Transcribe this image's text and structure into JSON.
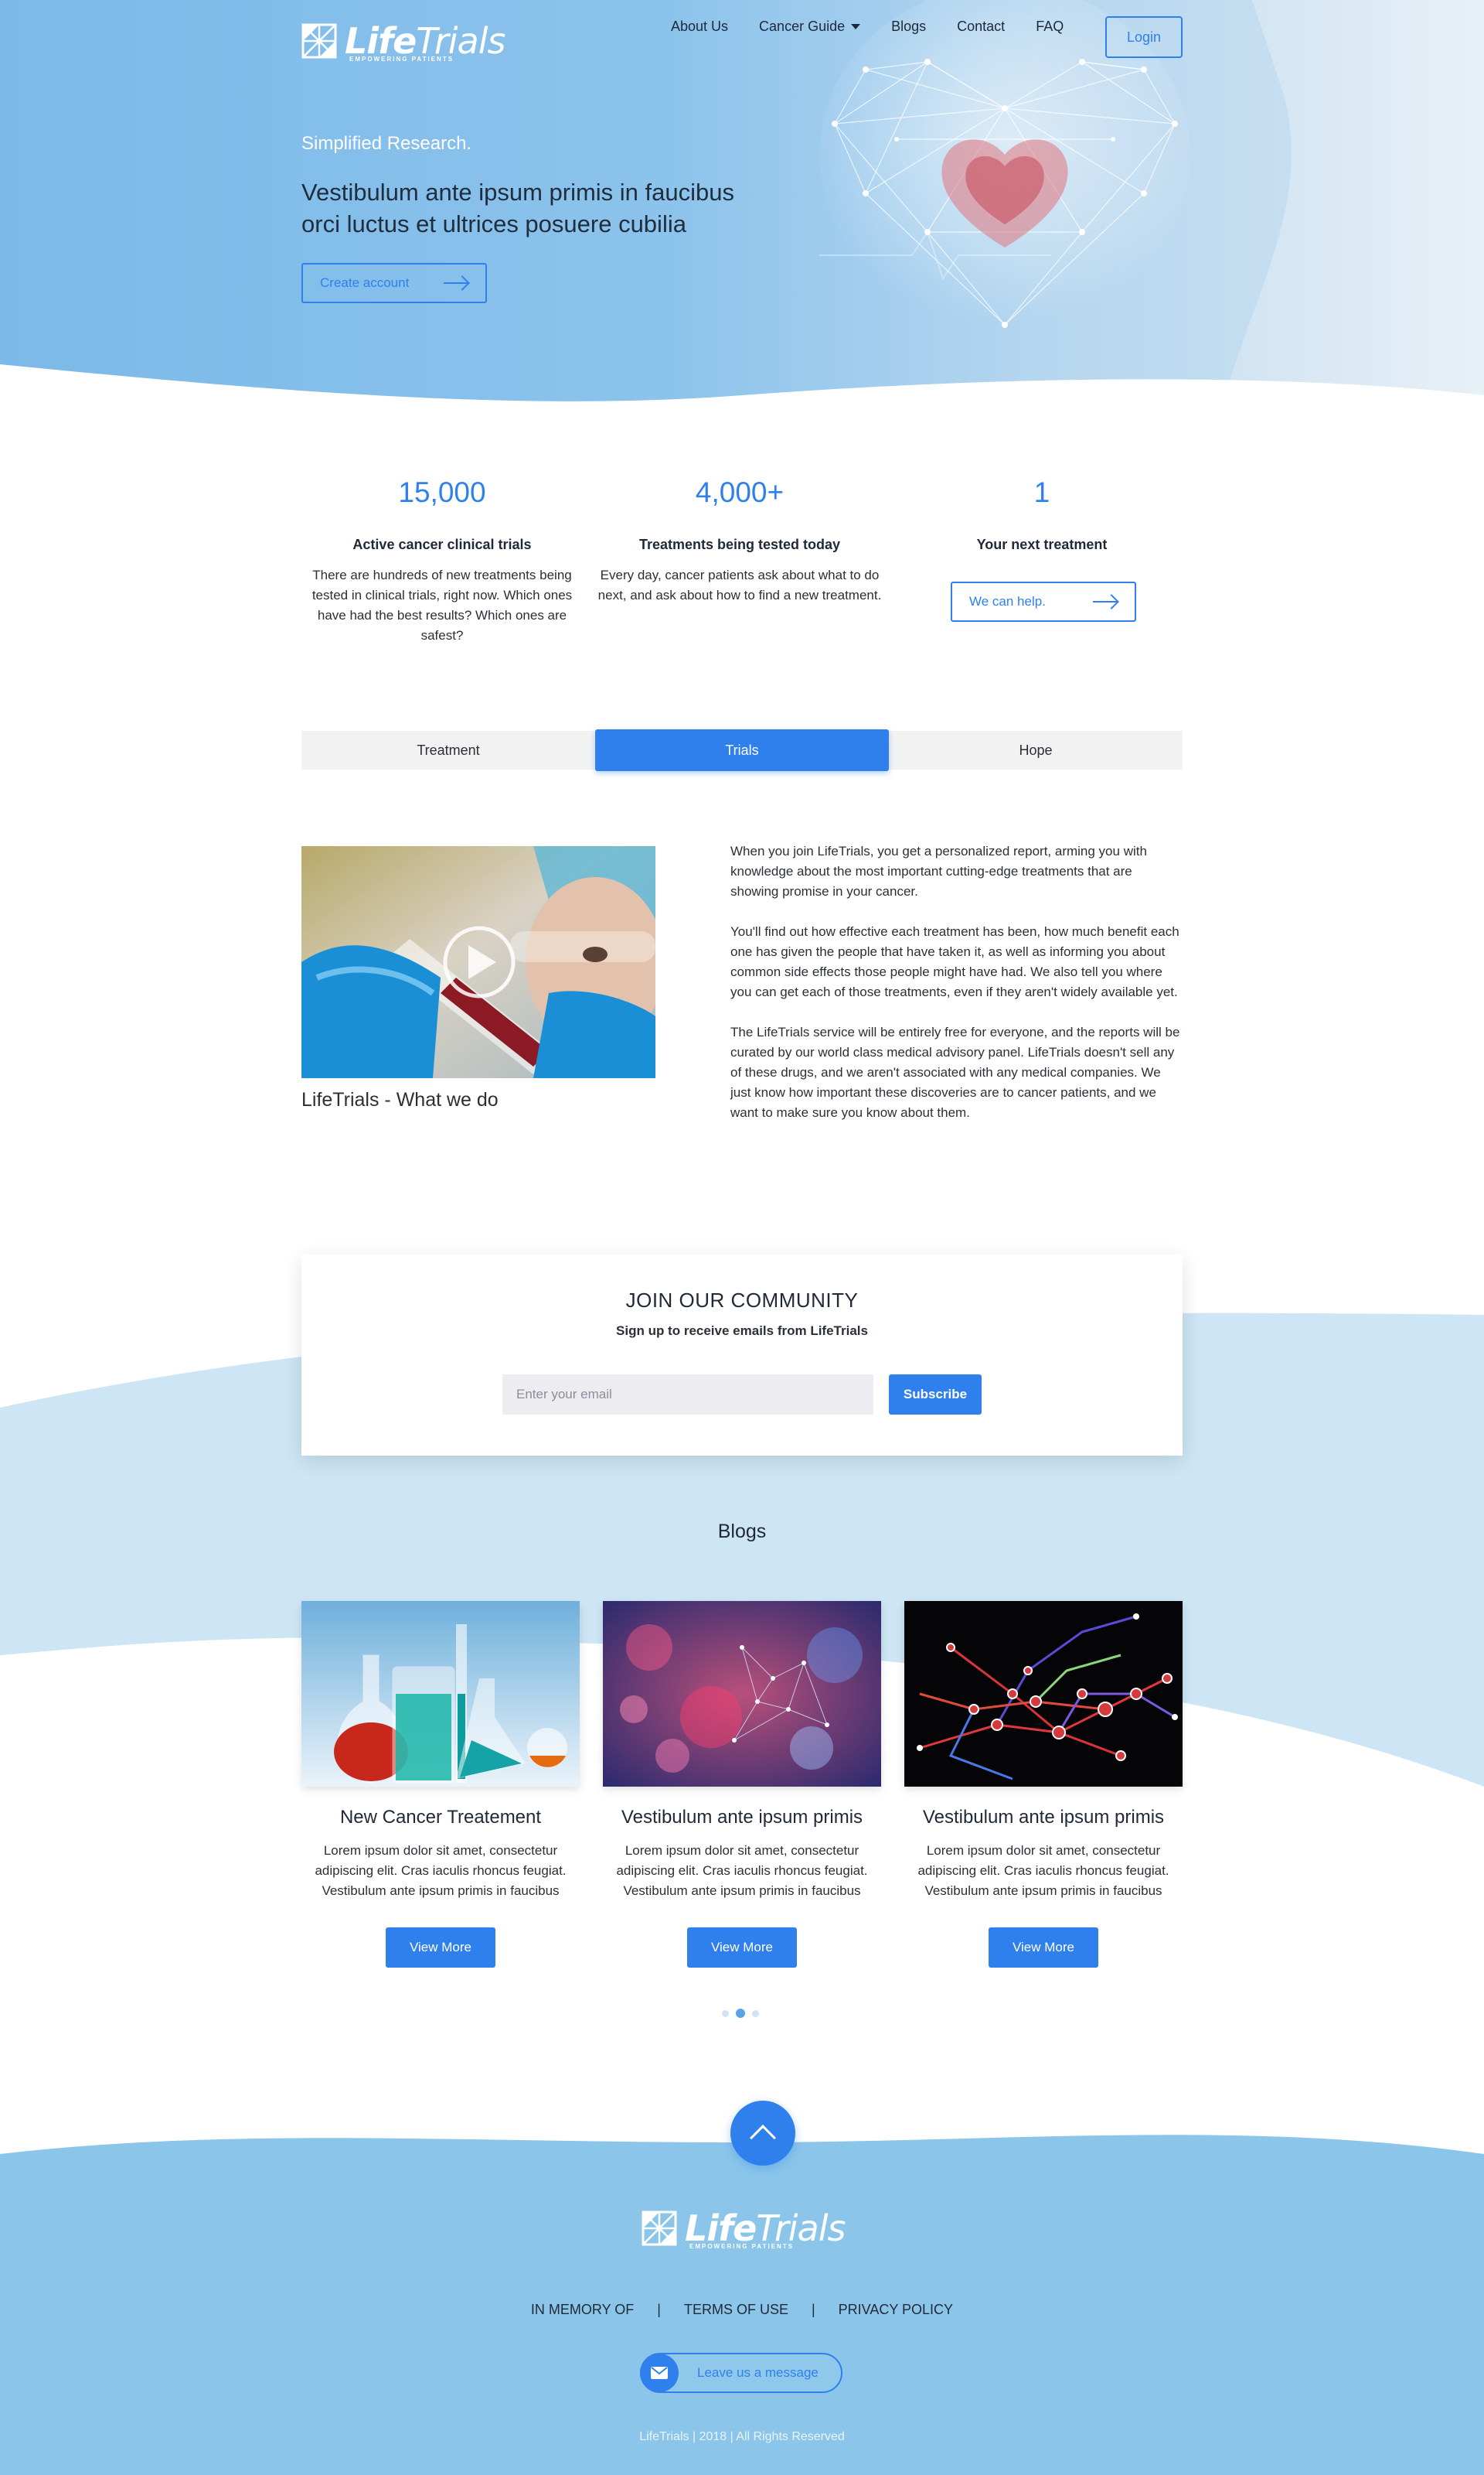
{
  "brand": {
    "name_bold": "Life",
    "name_light": "Trials",
    "tagline": "EMPOWERING PATIENTS",
    "primary_color": "#2f80ed",
    "hero_color": "#8cc3ec"
  },
  "nav": {
    "items": [
      {
        "label": "About Us"
      },
      {
        "label": "Cancer Guide",
        "has_dropdown": true
      },
      {
        "label": "Blogs"
      },
      {
        "label": "Contact"
      },
      {
        "label": "FAQ"
      }
    ],
    "login_label": "Login"
  },
  "hero": {
    "kicker": "Simplified Research.",
    "title": "Vestibulum ante ipsum primis in faucibus orci luctus et ultrices posuere cubilia",
    "cta_label": "Create account"
  },
  "stats": [
    {
      "number": "15,000",
      "heading": "Active cancer clinical trials",
      "text": "There are hundreds of new treatments being tested in clinical trials, right now. Which ones have had the best results? Which ones are safest?"
    },
    {
      "number": "4,000+",
      "heading": "Treatments being tested today",
      "text": "Every day, cancer patients ask about what to do next, and ask about how to find a new treatment."
    },
    {
      "number": "1",
      "heading": "Your next treatment",
      "button_label": "We can help."
    }
  ],
  "tabs": [
    {
      "label": "Treatment"
    },
    {
      "label": "Trials",
      "active": true
    },
    {
      "label": "Hope"
    }
  ],
  "about": {
    "video_caption": "LifeTrials - What we do",
    "paragraphs": [
      "When you join LifeTrials, you get a personalized report, arming you with knowledge about the most important cutting-edge treatments that are showing promise in your cancer.",
      "You'll find out how effective each treatment has been, how much benefit each one has given the people that have taken it, as well as informing you about common side effects those people might have had. We also tell you where you can get each of those treatments, even if they aren't widely available yet.",
      "The LifeTrials service will be entirely free for everyone, and the reports will be curated by our world class medical advisory panel. LifeTrials doesn't sell any of these drugs, and we aren't associated with any medical companies. We just know how important these discoveries are to cancer patients, and we want to make sure you know about them."
    ]
  },
  "community": {
    "title": "JOIN OUR COMMUNITY",
    "subtitle": "Sign up to receive emails from LifeTrials",
    "email_placeholder": "Enter your email",
    "subscribe_label": "Subscribe"
  },
  "blogs": {
    "title": "Blogs",
    "posts": [
      {
        "title": "New Cancer Treatement",
        "text": "Lorem ipsum dolor sit amet, consectetur adipiscing elit. Cras iaculis rhoncus feugiat. Vestibulum ante ipsum primis in faucibus",
        "button_label": "View More",
        "image": "lab-flasks"
      },
      {
        "title": "Vestibulum ante ipsum primis",
        "text": "Lorem ipsum dolor sit amet, consectetur adipiscing elit. Cras iaculis rhoncus feugiat. Vestibulum ante ipsum primis in faucibus",
        "button_label": "View More",
        "image": "bokeh-network"
      },
      {
        "title": "Vestibulum ante ipsum primis",
        "text": "Lorem ipsum dolor sit amet, consectetur adipiscing elit. Cras iaculis rhoncus feugiat. Vestibulum ante ipsum primis in faucibus",
        "button_label": "View More",
        "image": "neural-network"
      }
    ],
    "pagination": {
      "pages": 3,
      "active_page": 2
    }
  },
  "footer": {
    "links": [
      {
        "label": "IN MEMORY OF"
      },
      {
        "label": "TERMS OF USE"
      },
      {
        "label": "PRIVACY POLICY"
      }
    ],
    "separator": "|",
    "message_label": "Leave us a message",
    "copyright": "LifeTrials | 2018 | All Rights Reserved",
    "background": "#8bc6ea"
  }
}
